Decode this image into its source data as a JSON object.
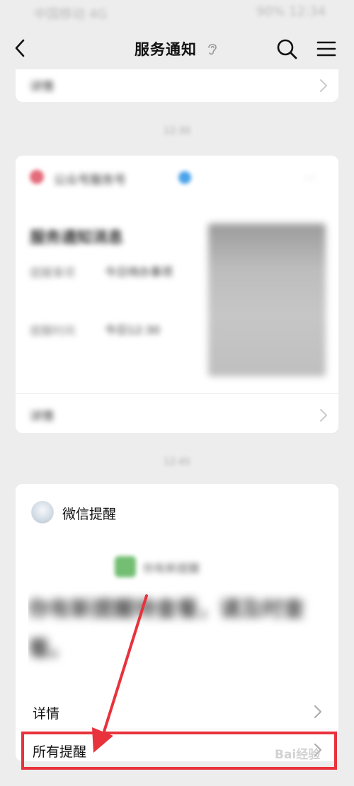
{
  "status_bar": {
    "left_text": "中国移动 4G",
    "right_text": "90% 12:34"
  },
  "nav": {
    "title": "服务通知"
  },
  "top_card": {
    "row_label": "详情"
  },
  "mid_time": "12:30",
  "mid_card": {
    "source": "公众号服务号",
    "title": "服务通知消息",
    "fields": [
      {
        "label": "提醒事项",
        "value": "今日待办事项"
      },
      {
        "label": "提醒时间",
        "value": "今日12:30"
      }
    ],
    "row_label": "详情"
  },
  "bottom_time": "12:45",
  "wechat_card": {
    "name": "微信提醒",
    "sub_text": "你有新提醒",
    "body_text": "你有新提醒待查看，请及时查看。",
    "detail_label": "详情",
    "all_label": "所有提醒"
  },
  "watermark": "Bai经验",
  "colors": {
    "highlight": "#e8323c",
    "background": "#ededed",
    "card": "#ffffff"
  }
}
